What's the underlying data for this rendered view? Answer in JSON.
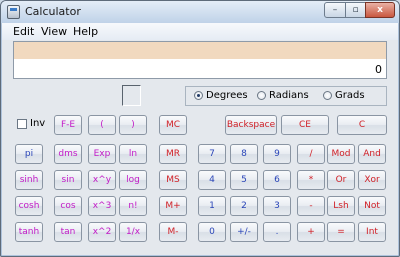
{
  "window": {
    "title": "Calculator",
    "minimize_glyph": "–",
    "maximize_glyph": "▫",
    "close_glyph": "x"
  },
  "menu": [
    "Edit",
    "View",
    "Help"
  ],
  "display": {
    "value": "0"
  },
  "angle_units": {
    "options": [
      "Degrees",
      "Radians",
      "Grads"
    ],
    "selected": "Degrees"
  },
  "inv": {
    "label": "Inv",
    "checked": false
  },
  "buttons": {
    "row0": [
      "F-E",
      "(",
      ")",
      "MC",
      "Backspace",
      "CE",
      "C"
    ],
    "row1": [
      "pi",
      "dms",
      "Exp",
      "ln",
      "MR",
      "7",
      "8",
      "9",
      "/",
      "Mod",
      "And"
    ],
    "row2": [
      "sinh",
      "sin",
      "x^y",
      "log",
      "MS",
      "4",
      "5",
      "6",
      "*",
      "Or",
      "Xor"
    ],
    "row3": [
      "cosh",
      "cos",
      "x^3",
      "n!",
      "M+",
      "1",
      "2",
      "3",
      "-",
      "Lsh",
      "Not"
    ],
    "row4": [
      "tanh",
      "tan",
      "x^2",
      "1/x",
      "M-",
      "0",
      "+/-",
      ".",
      "+",
      "=",
      "Int"
    ]
  },
  "colors": {
    "function": "#c21bc7",
    "memory_and_ops": "#d02027",
    "digits": "#2a45b8"
  }
}
